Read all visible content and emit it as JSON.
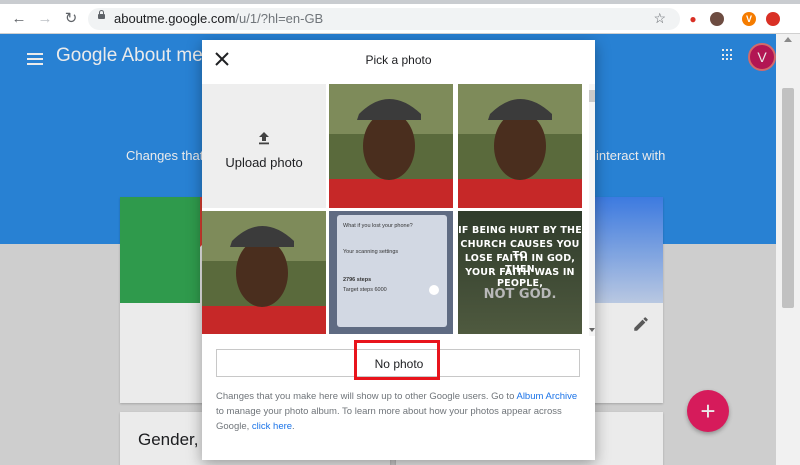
{
  "browser": {
    "url_host": "aboutme.google.com",
    "url_path": "/u/1/?hl=en-GB",
    "profile_initial": "V"
  },
  "app": {
    "brand": "Google About me",
    "avatar_initial": "V",
    "bg_text_left": "Changes that",
    "bg_text_right": "interact with",
    "gender_label": "Gender, d"
  },
  "dialog": {
    "title": "Pick a photo",
    "upload_label": "Upload photo",
    "phone_lines": [
      "What if you lost your phone?",
      "Your scanning settings",
      "2796 steps",
      "Target steps 6000"
    ],
    "quote_lines": [
      "IF BEING HURT BY THE",
      "CHURCH CAUSES YOU TO",
      "LOSE FAITH IN GOD, THEN",
      "YOUR FAITH WAS IN PEOPLE,"
    ],
    "quote_not_god": "NOT GOD.",
    "no_photo_label": "No photo",
    "info_text_1": "Changes that you make here will show up to other Google users. Go to ",
    "info_link_1": "Album Archive",
    "info_text_2": " to manage your photo album. To learn more about how your photos appear across Google, ",
    "info_link_2": "click here",
    "info_text_3": "."
  },
  "colors": {
    "header_blue": "#2c8ce5",
    "fab_pink": "#e91e63",
    "highlight_red": "#e8141c",
    "link_blue": "#1a73e8"
  },
  "icons": [
    "back-icon",
    "forward-icon",
    "reload-icon",
    "lock-icon",
    "star-icon",
    "menu-icon",
    "apps-icon",
    "close-icon",
    "upload-icon",
    "edit-icon",
    "plus-icon"
  ]
}
